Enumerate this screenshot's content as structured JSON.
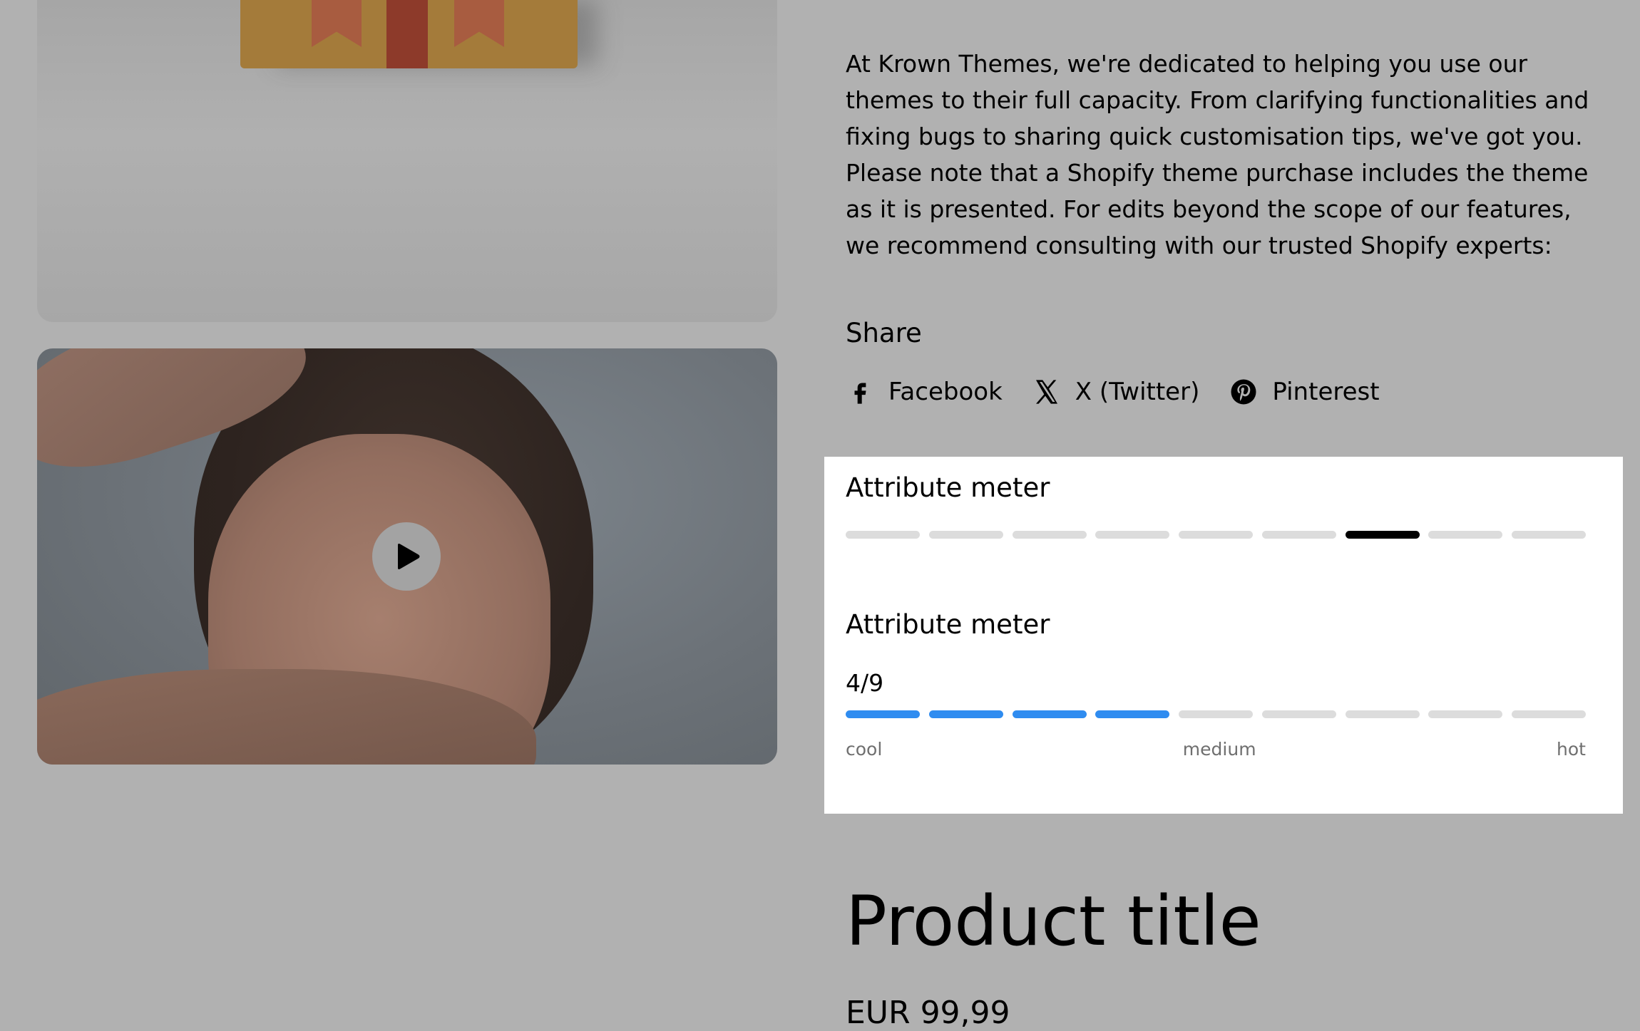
{
  "description": "At Krown Themes, we're dedicated to helping you use our themes to their full capacity. From clarifying functionalities and fixing bugs to sharing quick customisation tips, we've got you. Please note that a Shopify theme purchase includes the theme as it is presented. For edits beyond the scope of our features, we recommend consulting with our trusted Shopify experts:",
  "share": {
    "title": "Share",
    "links": [
      {
        "label": "Facebook",
        "icon": "facebook-icon"
      },
      {
        "label": "X (Twitter)",
        "icon": "x-icon"
      },
      {
        "label": "Pinterest",
        "icon": "pinterest-icon"
      }
    ]
  },
  "meters": [
    {
      "title": "Attribute meter",
      "segments": 9,
      "active_index": 6,
      "style": "single",
      "color": "#000000"
    },
    {
      "title": "Attribute meter",
      "value_label": "4/9",
      "segments": 9,
      "filled": 4,
      "style": "progress",
      "color": "#2f8cf0",
      "scale": {
        "low": "cool",
        "mid": "medium",
        "high": "hot"
      }
    }
  ],
  "media": {
    "play_icon": "play-icon"
  },
  "product": {
    "title": "Product title",
    "price": "EUR 99,99"
  }
}
